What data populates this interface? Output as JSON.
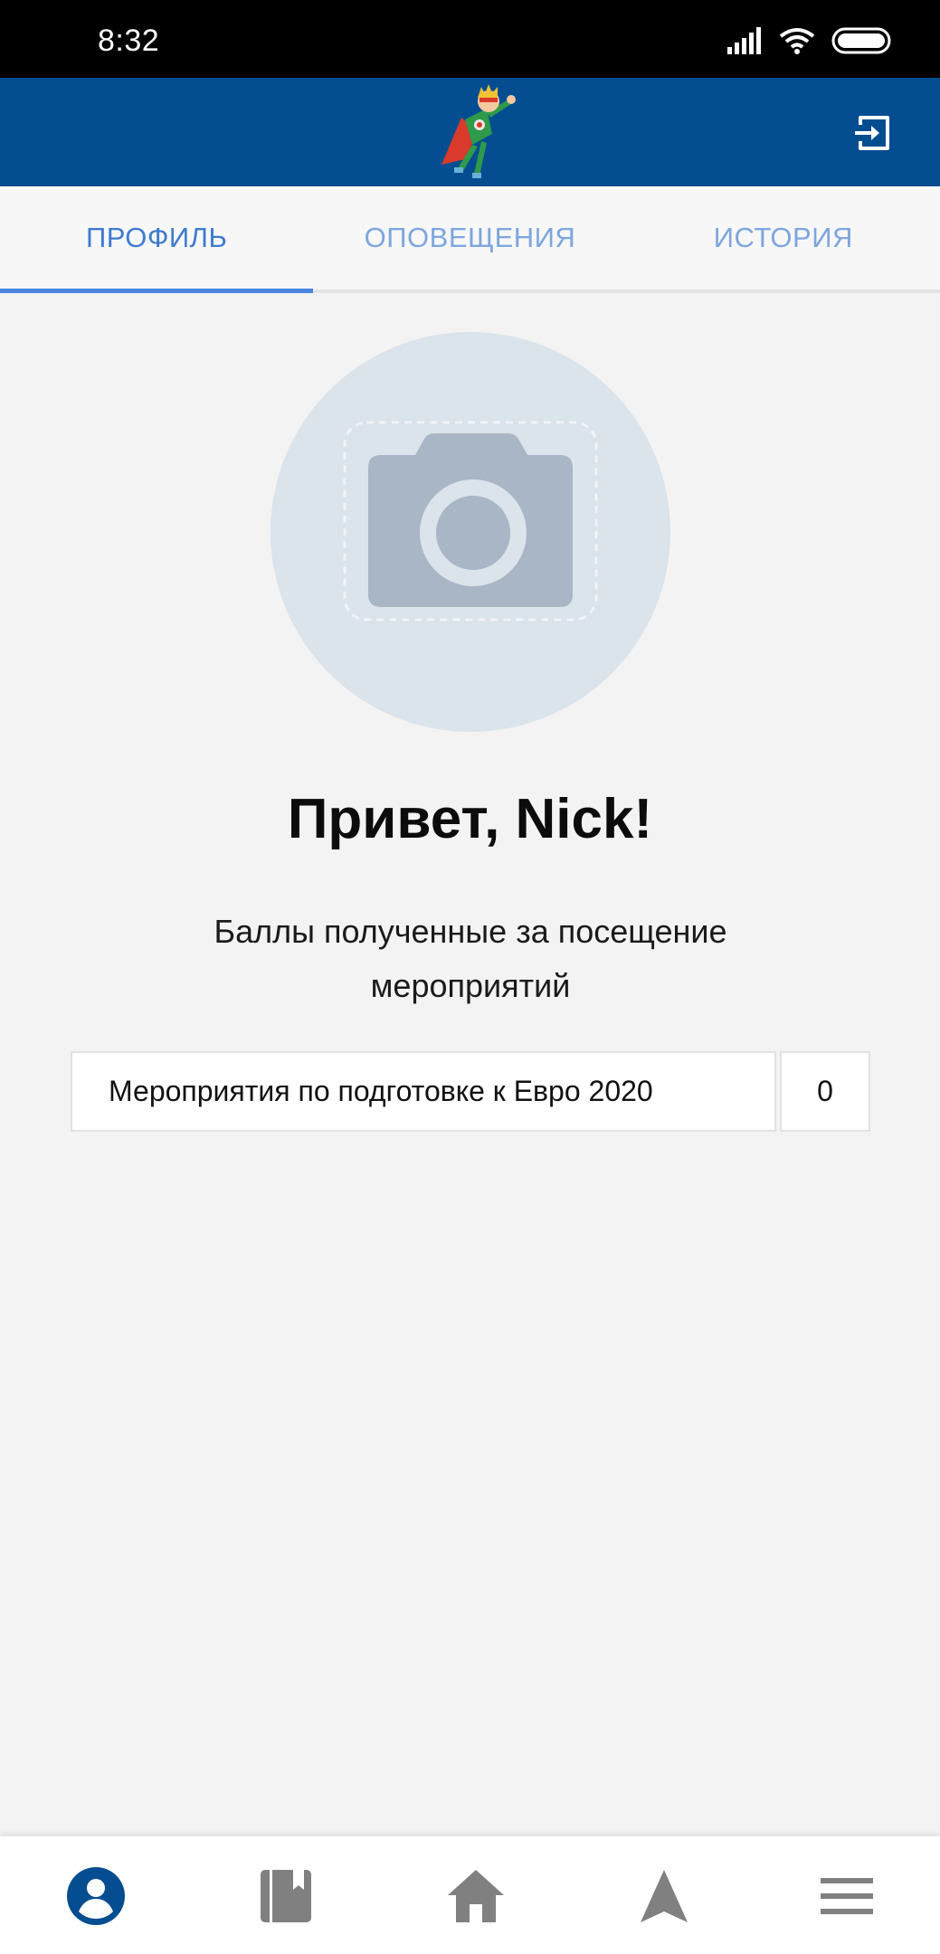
{
  "status_bar": {
    "time": "8:32",
    "icons": [
      "signal-icon",
      "wifi-icon",
      "battery-icon"
    ]
  },
  "app_bar": {
    "logo_icon": "superhero-mascot-logo",
    "exit_icon": "exit-icon",
    "background": "#054d91"
  },
  "tabs": [
    {
      "label": "ПРОФИЛЬ",
      "active": true
    },
    {
      "label": "ОПОВЕЩЕНИЯ",
      "active": false
    },
    {
      "label": "ИСТОРИЯ",
      "active": false
    }
  ],
  "profile": {
    "avatar_icon": "camera-placeholder-icon",
    "greeting": "Привет, Nick!",
    "points_heading": "Баллы полученные за посещение мероприятий"
  },
  "points_table": [
    {
      "event": "Мероприятия по подготовке к Евро 2020",
      "points": "0"
    }
  ],
  "bottom_nav": [
    {
      "icon": "profile-icon",
      "active": true
    },
    {
      "icon": "book-icon",
      "active": false
    },
    {
      "icon": "home-icon",
      "active": false
    },
    {
      "icon": "navigation-icon",
      "active": false
    },
    {
      "icon": "menu-icon",
      "active": false
    }
  ],
  "colors": {
    "accent": "#3f7bcf",
    "active_nav": "#054d91",
    "inactive_nav": "#808080"
  }
}
